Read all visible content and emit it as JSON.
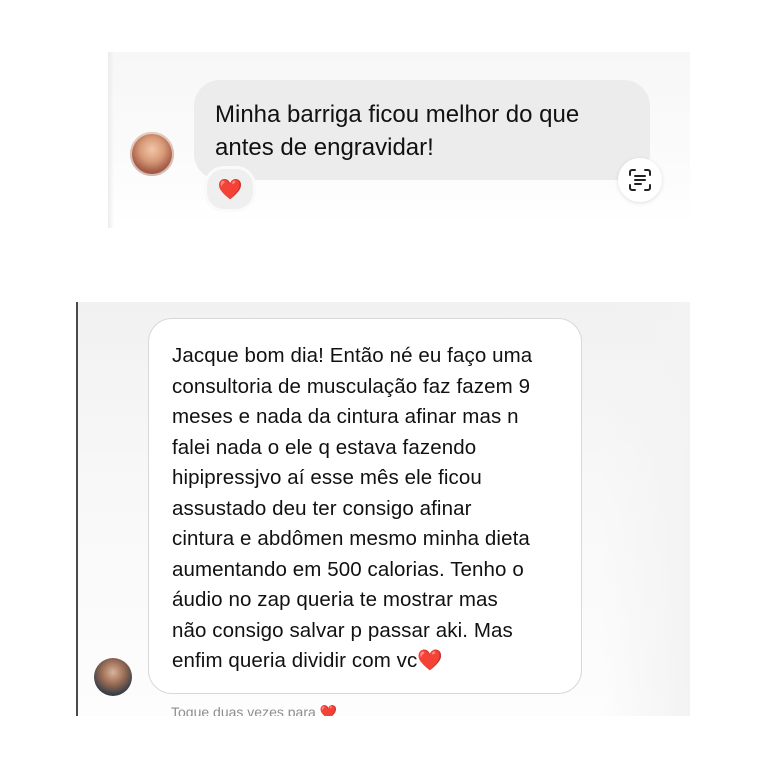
{
  "screenshot1": {
    "message": "Minha barriga ficou melhor do que\nantes de engravidar!",
    "reaction": "❤️",
    "translate_icon": "text-scan-icon",
    "avatar": "profile-avatar"
  },
  "screenshot2": {
    "message": "Jacque bom dia! Então né eu faço uma\nconsultoria de musculação faz fazem 9\nmeses e nada da cintura afinar mas n\nfalei nada o ele q estava fazendo\nhipipressjvo aí esse mês ele ficou\nassustado deu ter consigo afinar\ncintura e abdômen mesmo minha dieta\naumentando em 500 calorias. Tenho o\náudio no zap queria te mostrar mas\nnão consigo salvar p passar aki. Mas\nenfim queria dividir com vc",
    "message_emoji": "❤️",
    "hint": "Toque duas vezes para",
    "hint_emoji": "❤️",
    "avatar": "profile-avatar"
  },
  "colors": {
    "bubble_gray": "#ececed",
    "heart": "#e0242c",
    "text": "#111111",
    "hint": "#8e8e8e"
  }
}
